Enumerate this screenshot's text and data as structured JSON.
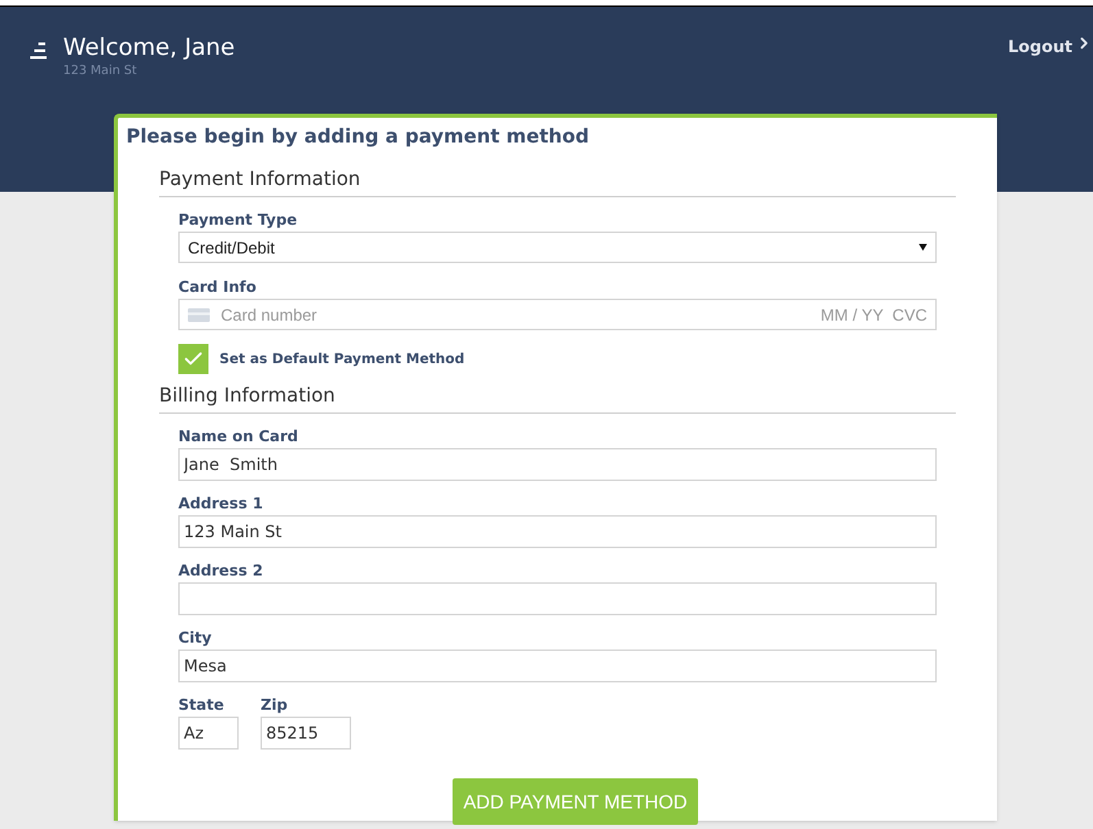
{
  "header": {
    "title": "Welcome, Jane",
    "subtitle": "123 Main St",
    "logout": "Logout"
  },
  "card": {
    "title": "Please begin by adding a payment method",
    "payment_section": {
      "heading": "Payment Information",
      "payment_type": {
        "label": "Payment Type",
        "value": "Credit/Debit"
      },
      "card_info": {
        "label": "Card Info",
        "placeholder": "Card number",
        "expiry_cvc": "MM / YY  CVC"
      },
      "default_checkbox": {
        "label": "Set as Default Payment Method",
        "checked": true
      }
    },
    "billing_section": {
      "heading": "Billing Information",
      "fields": [
        {
          "label": "Name on Card",
          "value": "Jane  Smith"
        },
        {
          "label": "Address 1",
          "value": "123 Main St"
        },
        {
          "label": "Address 2"
        },
        {
          "label": "City",
          "value": "Mesa"
        }
      ],
      "state": {
        "label": "State",
        "value": "Az"
      },
      "zip": {
        "label": "Zip",
        "value": "85215"
      }
    },
    "button": "ADD PAYMENT METHOD"
  }
}
